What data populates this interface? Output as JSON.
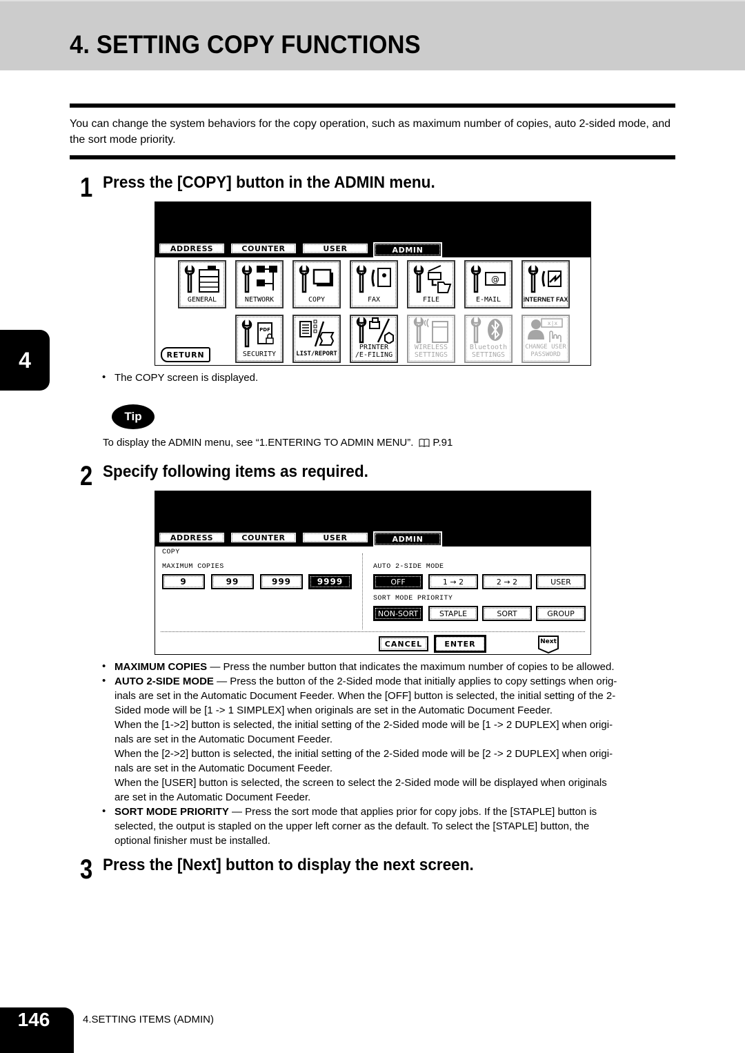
{
  "header": {
    "title": "4. SETTING COPY FUNCTIONS"
  },
  "intro": "You can change the system behaviors for the copy operation, such as maximum number of copies, auto 2-sided mode, and the sort mode priority.",
  "chapter_tab": "4",
  "steps": [
    {
      "number": "1",
      "title": "Press the [COPY] button in the ADMIN menu."
    },
    {
      "number": "2",
      "title": "Specify following items as required."
    },
    {
      "number": "3",
      "title": "Press the [Next] button to display the next screen."
    }
  ],
  "screen1": {
    "tabs": [
      "ADDRESS",
      "COUNTER",
      "USER",
      "ADMIN"
    ],
    "active_tab": "ADMIN",
    "icons_row1": [
      {
        "label": "GENERAL",
        "icon": "general-icon"
      },
      {
        "label": "NETWORK",
        "icon": "network-icon"
      },
      {
        "label": "COPY",
        "icon": "copy-icon"
      },
      {
        "label": "FAX",
        "icon": "fax-icon"
      },
      {
        "label": "FILE",
        "icon": "file-icon"
      },
      {
        "label": "E-MAIL",
        "icon": "email-icon"
      },
      {
        "label": "INTERNET FAX",
        "icon": "internet-fax-icon"
      }
    ],
    "icons_row2": [
      {
        "label": "SECURITY",
        "icon": "security-icon",
        "enabled": true
      },
      {
        "label": "LIST/REPORT",
        "icon": "list-report-icon",
        "enabled": true
      },
      {
        "label": "PRINTER\n/E-FILING",
        "label1": "PRINTER",
        "label2": "/E-FILING",
        "icon": "printer-efiling-icon",
        "enabled": true
      },
      {
        "label1": "WIRELESS",
        "label2": "SETTINGS",
        "icon": "wireless-settings-icon",
        "enabled": false
      },
      {
        "label1": "Bluetooth",
        "label2": "SETTINGS",
        "icon": "bluetooth-settings-icon",
        "enabled": false
      },
      {
        "label1": "CHANGE USER",
        "label2": "PASSWORD",
        "icon": "change-user-password-icon",
        "enabled": false
      }
    ],
    "return_label": "RETURN",
    "caption": "The COPY screen is displayed."
  },
  "tip": {
    "badge": "Tip",
    "text": "To display the ADMIN menu, see “1.ENTERING TO ADMIN MENU”.",
    "ref": "P.91"
  },
  "screen2": {
    "tabs": [
      "ADDRESS",
      "COUNTER",
      "USER",
      "ADMIN"
    ],
    "active_tab": "ADMIN",
    "section_title": "COPY",
    "max_copies": {
      "label": "MAXIMUM COPIES",
      "options": [
        "9",
        "99",
        "999",
        "9999"
      ],
      "selected": "9999"
    },
    "auto_2side": {
      "label": "AUTO 2-SIDE MODE",
      "options": [
        "OFF",
        "1 → 2",
        "2 → 2",
        "USER"
      ],
      "selected": "OFF"
    },
    "sort_priority": {
      "label": "SORT MODE PRIORITY",
      "options": [
        "NON-SORT",
        "STAPLE",
        "SORT",
        "GROUP"
      ],
      "selected": "NON-SORT"
    },
    "cancel_label": "CANCEL",
    "enter_label": "ENTER",
    "next_label": "Next"
  },
  "notes": {
    "max_copies_term": "MAXIMUM COPIES",
    "max_copies_text": " — Press the number button that indicates the maximum number of copies to be allowed.",
    "auto_term": "AUTO 2-SIDE MODE",
    "auto_text_1": " — Press the button of the 2-Sided mode that initially applies to copy settings when orig-",
    "auto_text_2": "inals are set in the Automatic Document Feeder.  When the [OFF] button is selected, the initial setting of the 2-",
    "auto_text_3": "Sided mode will be [1 -> 1 SIMPLEX] when originals are set in the Automatic Document Feeder.",
    "auto_text_4": "When the [1->2] button is selected, the initial setting of the 2-Sided mode will be [1 -> 2 DUPLEX] when origi-",
    "auto_text_5": "nals are set in the Automatic Document Feeder.",
    "auto_text_6": "When the [2->2] button is selected, the initial setting of the 2-Sided mode will be [2 -> 2 DUPLEX] when origi-",
    "auto_text_7": "nals are set in the Automatic Document Feeder.",
    "auto_text_8": "When the [USER] button is selected, the screen to select the 2-Sided mode will be displayed when originals",
    "auto_text_9": "are set in the Automatic Document Feeder.",
    "sort_term": "SORT MODE PRIORITY",
    "sort_text_1": " — Press the sort mode that applies prior for copy jobs.  If the [STAPLE] button is",
    "sort_text_2": "selected, the output is stapled on the upper left corner as the default.  To select the [STAPLE] button, the",
    "sort_text_3": "optional finisher must be installed."
  },
  "footer": {
    "page_number": "146",
    "section": "4.SETTING ITEMS (ADMIN)"
  }
}
